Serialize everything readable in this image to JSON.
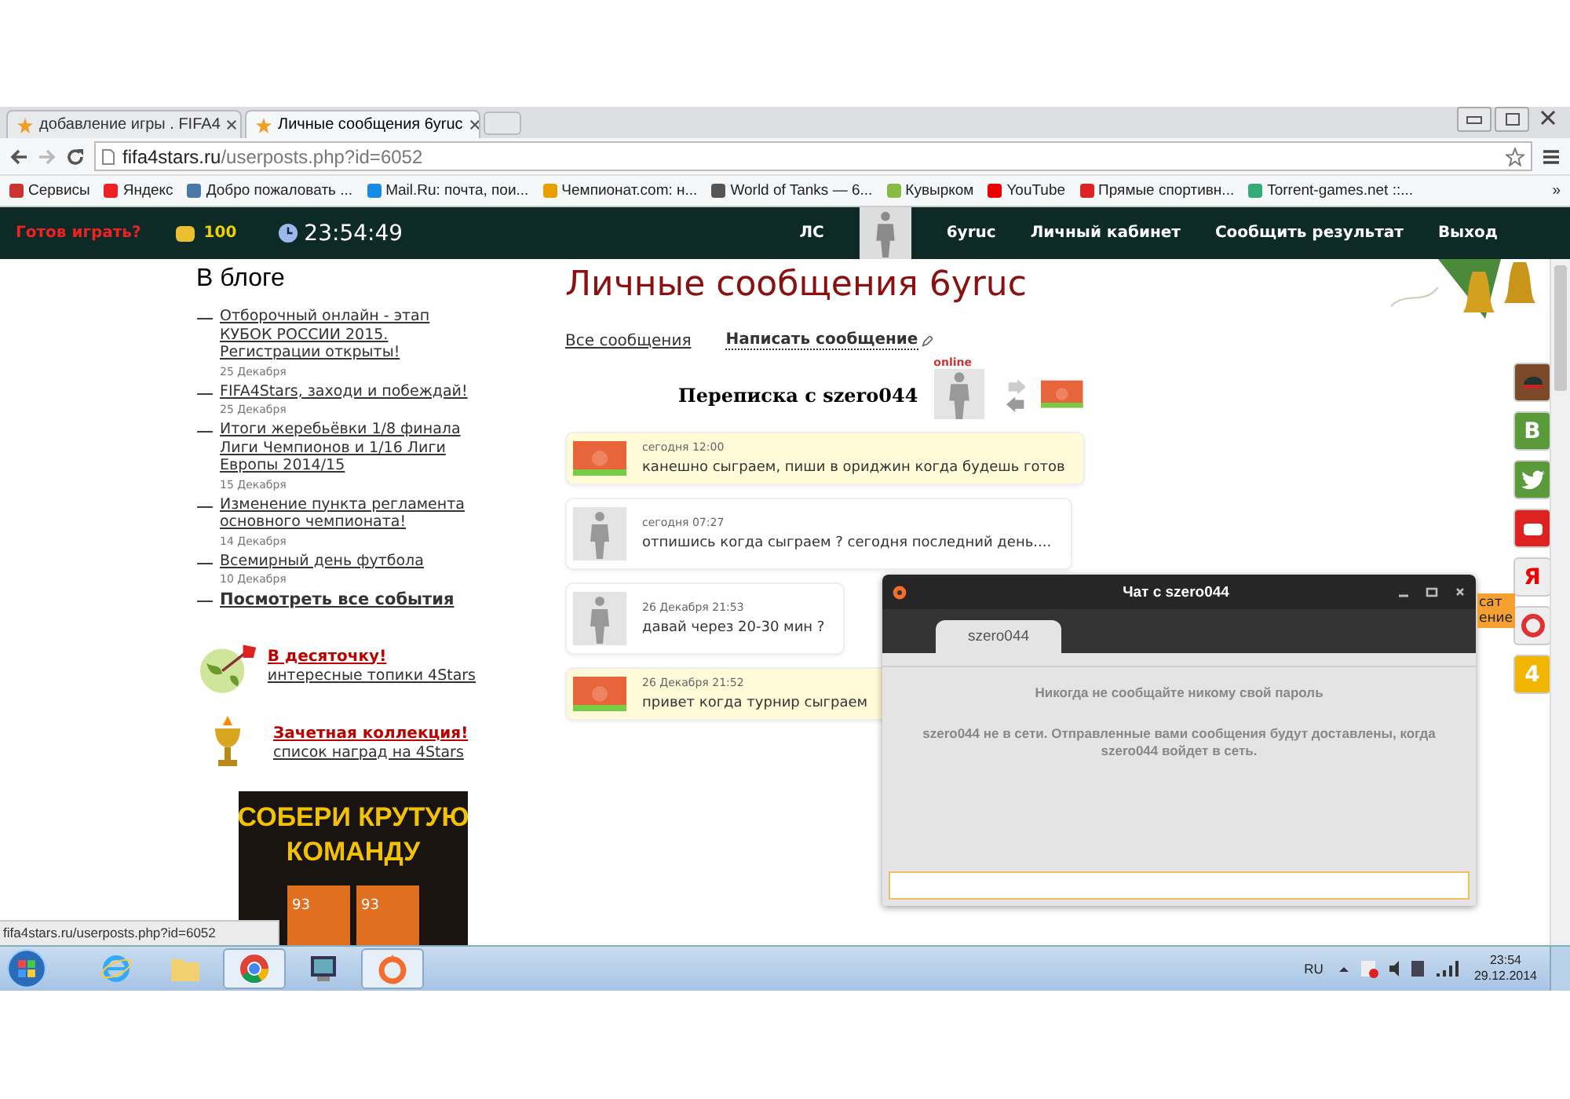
{
  "browser": {
    "tabs": [
      {
        "title": "добавление игры . FIFA4",
        "selected": false
      },
      {
        "title": "Личные сообщения 6yruc",
        "selected": true
      }
    ],
    "address": {
      "host": "fifa4stars.ru",
      "path": "/userposts.php?id=6052"
    },
    "bookmarks": [
      {
        "kind": "apps",
        "label": "Сервисы"
      },
      {
        "kind": "yandex",
        "label": "Яндекс"
      },
      {
        "kind": "vk",
        "label": "Добро пожаловать ..."
      },
      {
        "kind": "mail",
        "label": "Mail.Ru: почта, пои..."
      },
      {
        "kind": "champ",
        "label": "Чемпионат.com: н..."
      },
      {
        "kind": "tank",
        "label": "World of Tanks — 6..."
      },
      {
        "kind": "ball",
        "label": "Кувырком"
      },
      {
        "kind": "youtube",
        "label": "YouTube"
      },
      {
        "kind": "live",
        "label": "Прямые спортивн..."
      },
      {
        "kind": "globe",
        "label": "Torrent-games.net ::..."
      }
    ],
    "more": "»",
    "status_url": "fifa4stars.ru/userposts.php?id=6052"
  },
  "site": {
    "play": "Готов играть?",
    "coins": "100",
    "clock": "23:54:49",
    "nav": [
      {
        "kind": "link",
        "label": "ЛС"
      },
      {
        "kind": "avatar"
      },
      {
        "kind": "link",
        "label": "6yruc"
      },
      {
        "kind": "link",
        "label": "Личный кабинет"
      },
      {
        "kind": "link",
        "label": "Сообщить результат"
      },
      {
        "kind": "link",
        "label": "Выход"
      }
    ]
  },
  "blog": {
    "title": "В блоге",
    "marker": "—",
    "posts": [
      {
        "title": "Отборочный онлайн - этап КУБОК РОССИИ 2015. Регистрации открыты!",
        "date": "25 Декабря"
      },
      {
        "title": "FIFA4Stars, заходи и побеждай!",
        "date": "25 Декабря"
      },
      {
        "title": "Итоги жеребьёвки 1/8 финала Лиги Чемпионов и 1/16 Лиги Европы 2014/15",
        "date": "15 Декабря"
      },
      {
        "title": "Изменение пункта регламента основного чемпионата!",
        "date": "14 Декабря"
      },
      {
        "title": "Всемирный день футбола",
        "date": "10 Декабря"
      }
    ],
    "all_link": "Посмотреть все события"
  },
  "promos": [
    {
      "kind": "apple",
      "title": "В десяточку!",
      "subtitle": "интересные топики 4Stars"
    },
    {
      "kind": "cup",
      "title": "Зачетная коллекция!",
      "subtitle": "список наград на 4Stars"
    }
  ],
  "banner": {
    "lines": [
      "СОБЕРИ КРУТУЮ",
      "КОМАНДУ"
    ],
    "numbers": [
      "93",
      "93"
    ]
  },
  "main": {
    "heading": "Личные сообщения 6yruc",
    "links": [
      {
        "label": "Все сообщения",
        "selected": false
      },
      {
        "label": "Написать сообщение",
        "selected": true
      }
    ],
    "conversation": "Переписка с szero044",
    "online": "online",
    "messages": [
      {
        "kind": "mine",
        "time": "сегодня 12:00",
        "text": "канешно сыграем, пиши в ориджин когда будешь готов"
      },
      {
        "kind": "theirs",
        "time": "сегодня 07:27",
        "text": "отпишись когда сыграем ? сегодня последний день...."
      },
      {
        "kind": "theirs",
        "time": "26 Декабря 21:53",
        "text": "давай через 20-30 мин ?"
      },
      {
        "kind": "mine",
        "time": "26 Декабря 21:52",
        "text": "привет когда турнир сыграем"
      }
    ]
  },
  "side_icons": [
    {
      "kind": "cap"
    },
    {
      "kind": "vk",
      "glyph": "B"
    },
    {
      "kind": "twitter"
    },
    {
      "kind": "youtube"
    },
    {
      "kind": "yandex",
      "glyph": "Я"
    },
    {
      "kind": "buoy"
    },
    {
      "kind": "star",
      "glyph": "4"
    }
  ],
  "side_tab": [
    "сат",
    "ение"
  ],
  "chat": {
    "title": "Чат с szero044",
    "tab": "szero044",
    "notice": "Никогда не сообщайте никому свой пароль",
    "offline": "szero044 не в сети. Отправленные вами сообщения будут доставлены, когда szero044 войдет в сеть."
  },
  "taskbar": {
    "apps": [
      {
        "kind": "ie",
        "active": false
      },
      {
        "kind": "folder",
        "active": false
      },
      {
        "kind": "chrome",
        "active": true
      },
      {
        "kind": "monitor",
        "active": false
      },
      {
        "kind": "origin",
        "active": true
      }
    ],
    "lang": "RU",
    "time": "23:54",
    "date": "29.12.2014"
  }
}
